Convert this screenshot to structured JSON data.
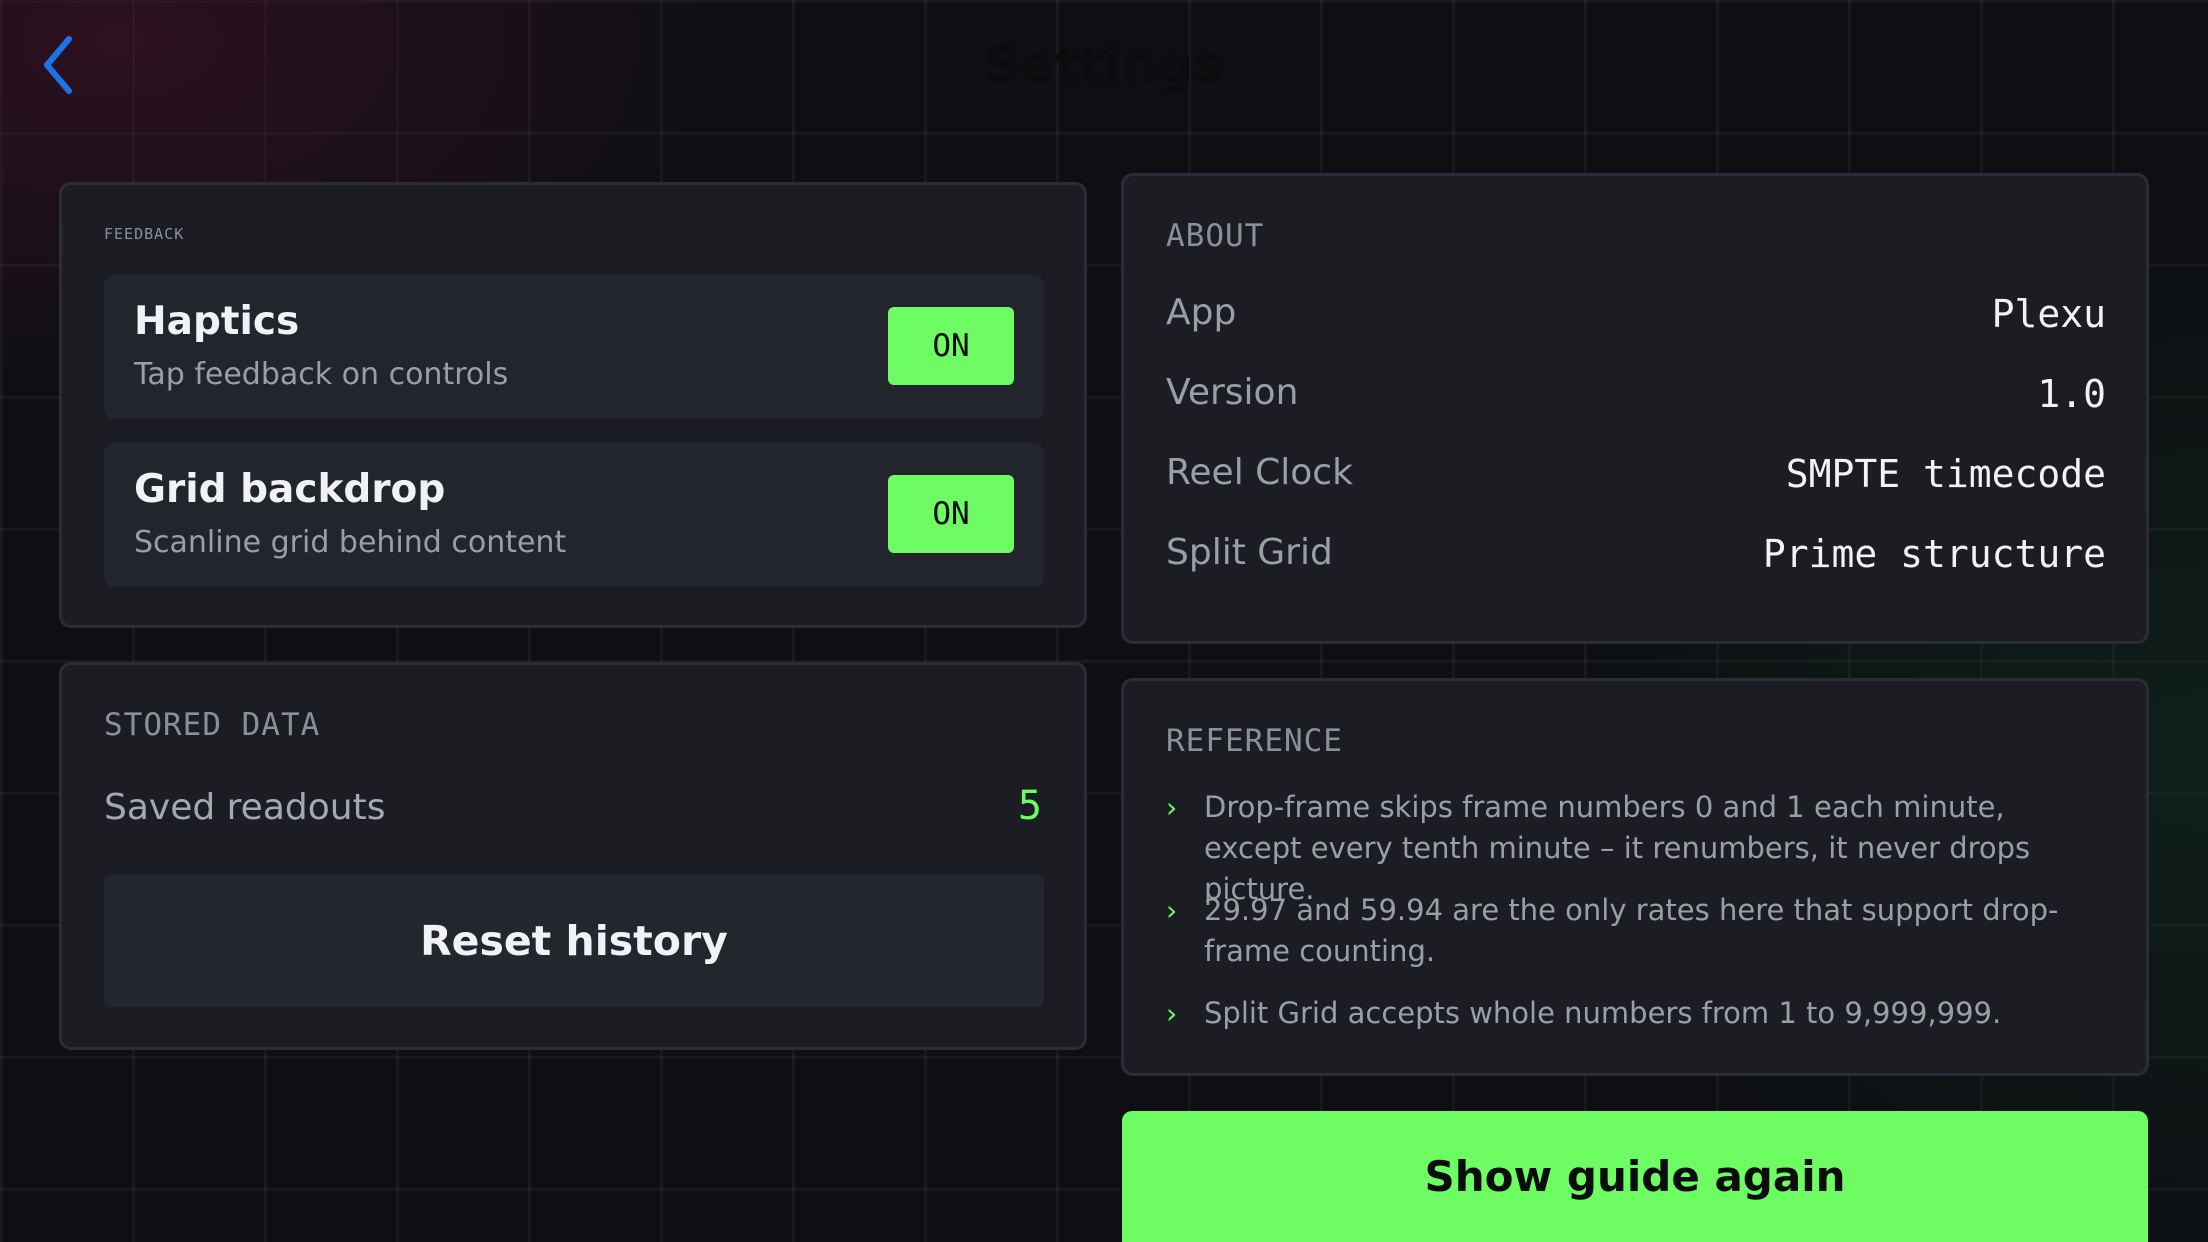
{
  "header": {
    "title": "Settings",
    "back_icon": "chevron-left-icon",
    "accent_color": "#1a73e8"
  },
  "feedback": {
    "label": "FEEDBACK",
    "rows": [
      {
        "title": "Haptics",
        "subtitle": "Tap feedback on controls",
        "state": "ON"
      },
      {
        "title": "Grid backdrop",
        "subtitle": "Scanline grid behind content",
        "state": "ON"
      }
    ]
  },
  "stored_data": {
    "label": "STORED DATA",
    "saved_readouts_label": "Saved readouts",
    "saved_readouts_value": "5",
    "reset_label": "Reset history"
  },
  "about": {
    "label": "ABOUT",
    "rows": [
      {
        "key": "App",
        "value": "Plexu"
      },
      {
        "key": "Version",
        "value": "1.0"
      },
      {
        "key": "Reel Clock",
        "value": "SMPTE timecode"
      },
      {
        "key": "Split Grid",
        "value": "Prime structure"
      }
    ]
  },
  "reference": {
    "label": "REFERENCE",
    "bullet_icon": "chevron-right-icon",
    "items": [
      "Drop-frame skips frame numbers 0 and 1 each minute, except every tenth minute – it renumbers, it never drops picture.",
      "29.97 and 59.94 are the only rates here that support drop-frame counting.",
      "Split Grid accepts whole numbers from 1 to 9,999,999."
    ]
  },
  "actions": {
    "show_guide_label": "Show guide again"
  },
  "colors": {
    "accent_green": "#6dfd63",
    "card_bg": "#1b1d22",
    "page_bg": "#0d0f12"
  }
}
